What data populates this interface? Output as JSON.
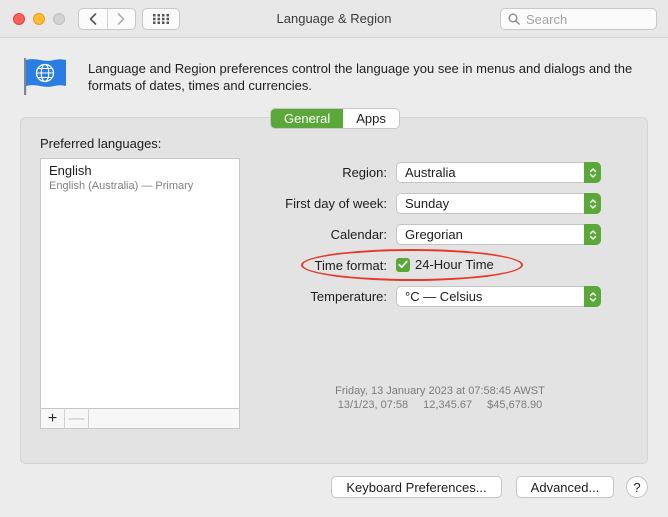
{
  "window": {
    "title": "Language & Region"
  },
  "toolbar": {
    "search_placeholder": "Search",
    "back_icon": "chevron-left-icon",
    "forward_icon": "chevron-right-icon",
    "grid_icon": "grid-icon"
  },
  "header": {
    "description": "Language and Region preferences control the language you see in menus and dialogs and the formats of dates, times and currencies."
  },
  "tabs": [
    {
      "label": "General",
      "active": true
    },
    {
      "label": "Apps",
      "active": false
    }
  ],
  "languages": {
    "label": "Preferred languages:",
    "items": [
      {
        "name": "English",
        "detail": "English (Australia) — Primary"
      }
    ],
    "add_label": "+",
    "remove_label": "—"
  },
  "settings": {
    "region": {
      "label": "Region:",
      "value": "Australia"
    },
    "first_day": {
      "label": "First day of week:",
      "value": "Sunday"
    },
    "calendar": {
      "label": "Calendar:",
      "value": "Gregorian"
    },
    "time_format": {
      "label": "Time format:",
      "checkbox_label": "24-Hour Time",
      "checked": true
    },
    "temperature": {
      "label": "Temperature:",
      "value": "°C — Celsius"
    }
  },
  "sample": {
    "line1": "Friday, 13 January 2023 at 07:58:45 AWST",
    "date": "13/1/23, 07:58",
    "number": "12,345.67",
    "currency": "$45,678.90"
  },
  "footer": {
    "keyboard_label": "Keyboard Preferences...",
    "advanced_label": "Advanced...",
    "help_label": "?"
  },
  "colors": {
    "accent": "#5aa83a",
    "annotation": "#e43a2c"
  }
}
